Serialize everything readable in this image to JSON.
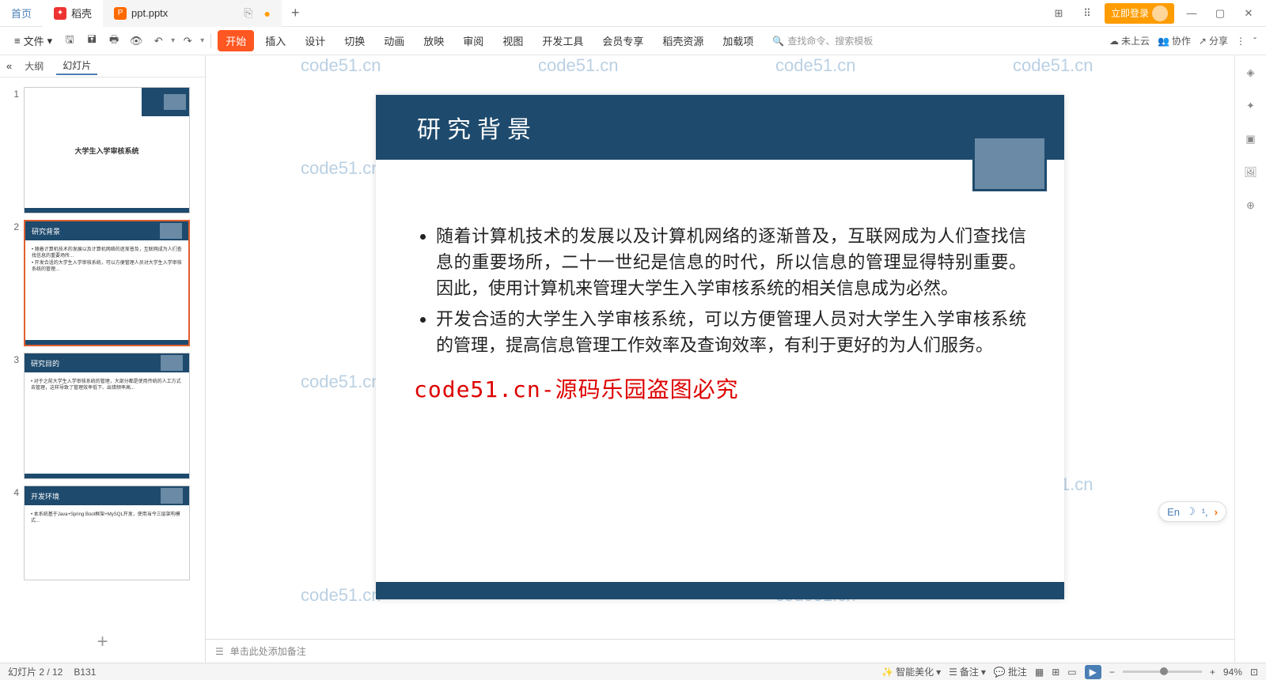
{
  "titlebar": {
    "home": "首页",
    "docker": "稻壳",
    "file": "ppt.pptx",
    "login": "立即登录"
  },
  "toolbar": {
    "file_menu": "文件",
    "tabs": [
      "开始",
      "插入",
      "设计",
      "切换",
      "动画",
      "放映",
      "审阅",
      "视图",
      "开发工具",
      "会员专享",
      "稻壳资源",
      "加载项"
    ],
    "search_placeholder": "查找命令、搜索模板",
    "cloud": "未上云",
    "coop": "协作",
    "share": "分享"
  },
  "sidepanel": {
    "collapse": "«",
    "outline": "大纲",
    "slides": "幻灯片",
    "thumbs": [
      {
        "n": "1",
        "title": "大学生入学审核系统",
        "is_title": true
      },
      {
        "n": "2",
        "title": "研究背景"
      },
      {
        "n": "3",
        "title": "研究目的"
      },
      {
        "n": "4",
        "title": "开发环境"
      }
    ]
  },
  "slide": {
    "title": "研究背景",
    "bullets": [
      "随着计算机技术的发展以及计算机网络的逐渐普及，互联网成为人们查找信息的重要场所，二十一世纪是信息的时代，所以信息的管理显得特别重要。因此，使用计算机来管理大学生入学审核系统的相关信息成为必然。",
      "开发合适的大学生入学审核系统，可以方便管理人员对大学生入学审核系统的管理，提高信息管理工作效率及查询效率，有利于更好的为人们服务。"
    ],
    "redtext": "code51.cn-源码乐园盗图必究"
  },
  "watermark": "code51.cn",
  "notes": {
    "placeholder": "单击此处添加备注"
  },
  "ime": {
    "lang": "En",
    "moon": "☽",
    "expand": "‹ ›",
    "arrow": "›"
  },
  "status": {
    "slide_pos": "幻灯片 2 / 12",
    "code": "B131",
    "beautify": "智能美化",
    "notes": "备注",
    "comments": "批注",
    "zoom": "94%"
  }
}
